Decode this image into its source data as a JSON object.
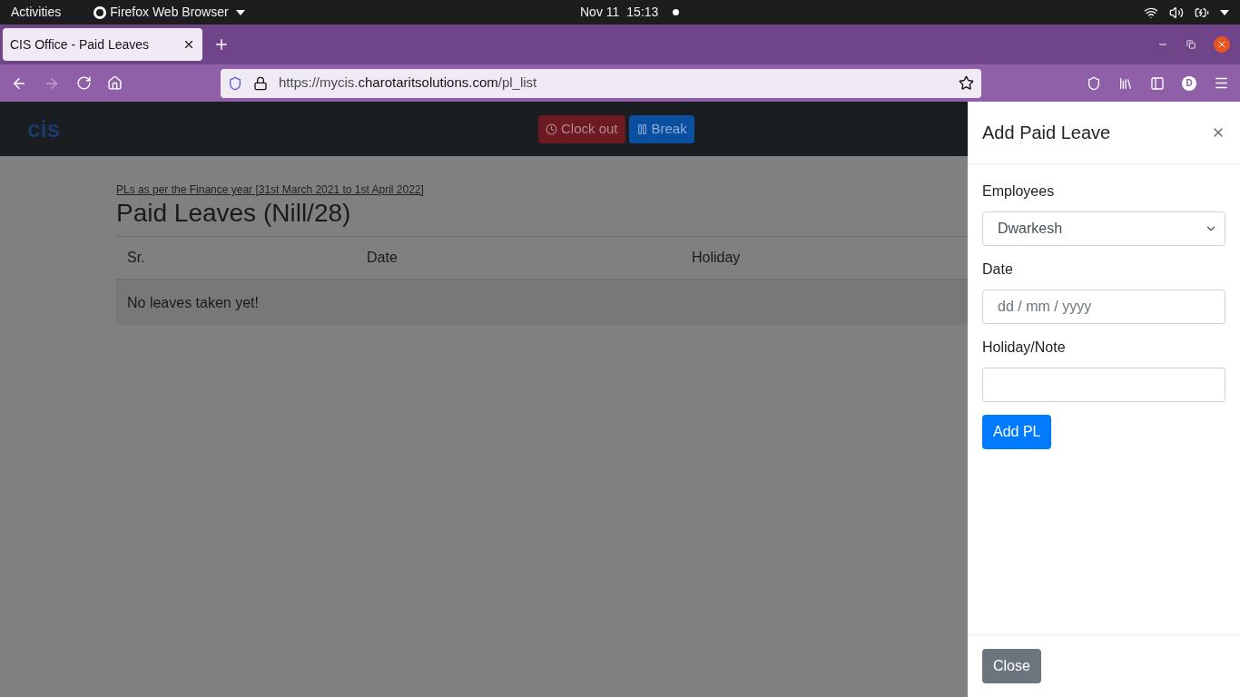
{
  "system_bar": {
    "activities": "Activities",
    "app_menu": "Firefox Web Browser",
    "date": "Nov 11",
    "time": "15:13"
  },
  "browser": {
    "tabs": [
      {
        "title": "CIS Office - Paid Leaves",
        "selected": true
      }
    ],
    "url": {
      "prefix": "https://mycis.",
      "domain": "charotaritsolutions.com",
      "path": "/pl_list"
    },
    "forward_disabled": true,
    "account_initial": "D"
  },
  "navbar": {
    "logo": "cis",
    "buttons": [
      {
        "label": "Clock out",
        "kind": "danger"
      },
      {
        "label": "Break",
        "kind": "primary"
      }
    ]
  },
  "page": {
    "finance_year_link": "PLs as per the Finance year [31st March 2021 to 1st April 2022]",
    "heading": "Paid Leaves (Nill/28)",
    "table": {
      "columns": [
        "Sr.",
        "Date",
        "Holiday"
      ],
      "empty_message": "No leaves taken yet!"
    }
  },
  "drawer": {
    "title": "Add Paid Leave",
    "fields": [
      {
        "label": "Employees",
        "kind": "select",
        "value": "Dwarkesh"
      },
      {
        "label": "Date",
        "kind": "date",
        "placeholder": "dd / mm / yyyy"
      },
      {
        "label": "Holiday/Note",
        "kind": "text"
      }
    ],
    "submit": "Add PL",
    "close": "Close"
  }
}
